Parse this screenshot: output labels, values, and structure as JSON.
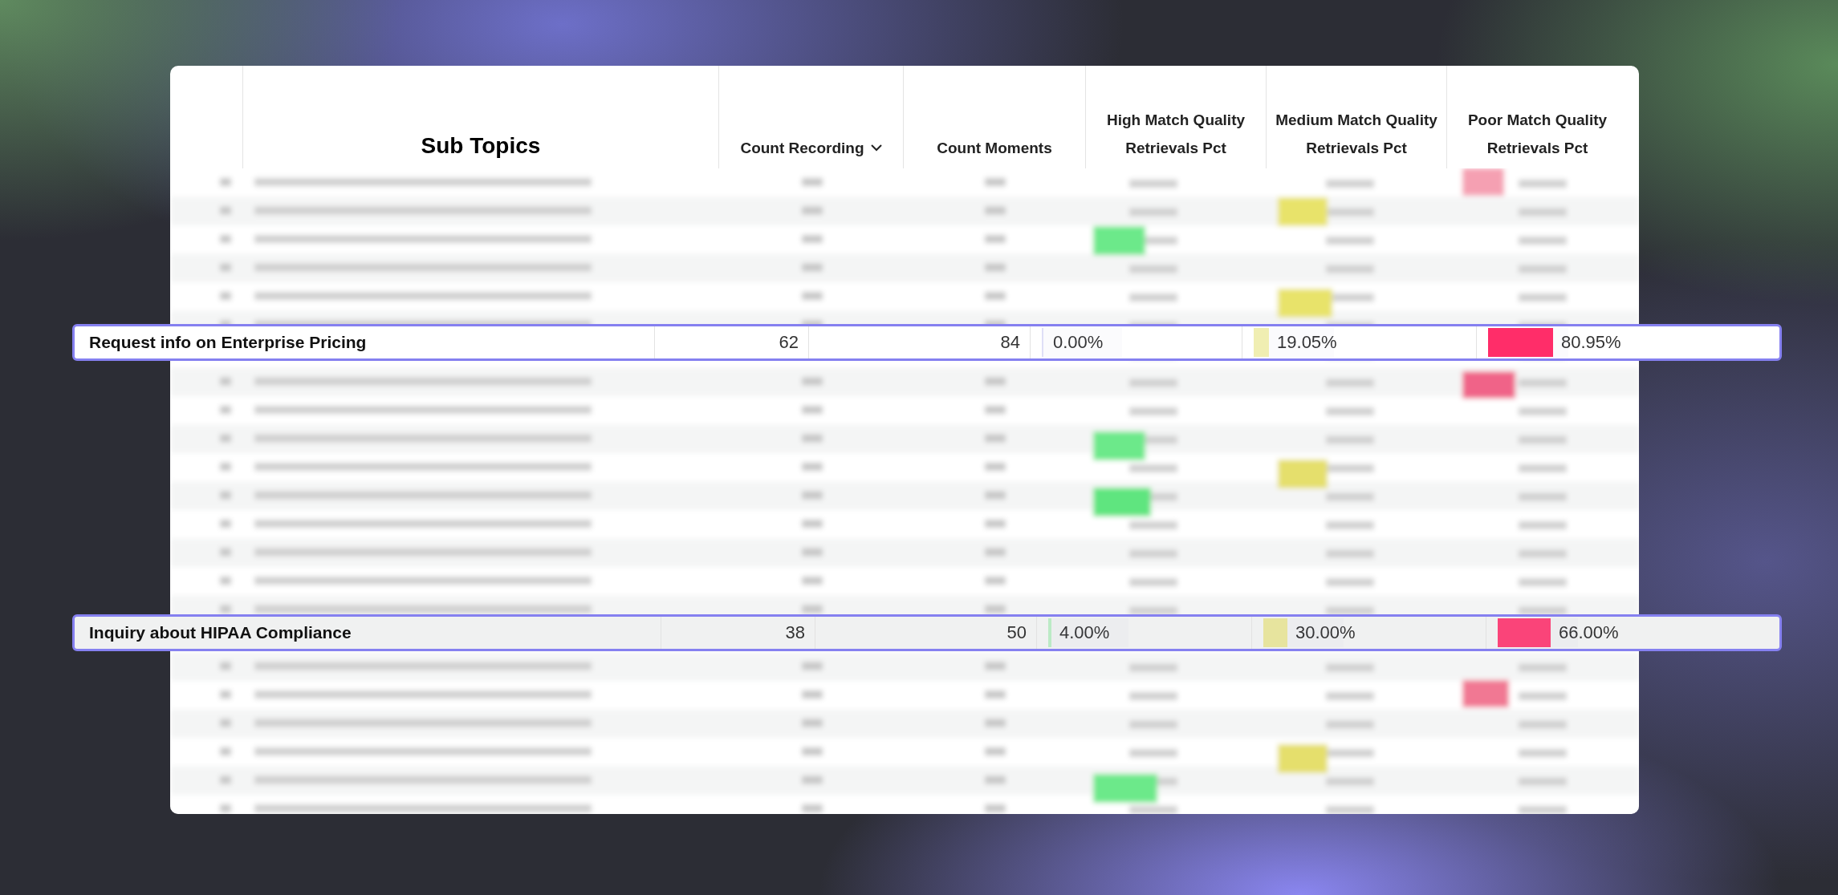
{
  "table": {
    "columns": [
      {
        "label": "Sub Topics",
        "sorted": false
      },
      {
        "label": "Count Recording",
        "sorted": true
      },
      {
        "label": "Count Moments",
        "sorted": false
      },
      {
        "label": "High Match Quality Retrievals Pct",
        "sorted": false
      },
      {
        "label": "Medium Match Quality Retrievals Pct",
        "sorted": false
      },
      {
        "label": "Poor Match Quality Retrievals Pct",
        "sorted": false
      }
    ]
  },
  "highlighted_rows": [
    {
      "sub_topic": "Request info on Enterprise Pricing",
      "count_recording": "62",
      "count_moments": "84",
      "shaded": false,
      "high": {
        "text": "0.00%",
        "level": 0.0
      },
      "medium": {
        "text": "19.05%",
        "level": 0.1905
      },
      "poor": {
        "text": "80.95%",
        "level": 0.8095
      }
    },
    {
      "sub_topic": "Inquiry about HIPAA Compliance",
      "count_recording": "38",
      "count_moments": "50",
      "shaded": true,
      "high": {
        "text": "4.00%",
        "level": 0.04
      },
      "medium": {
        "text": "30.00%",
        "level": 0.3
      },
      "poor": {
        "text": "66.00%",
        "level": 0.66
      }
    }
  ]
}
